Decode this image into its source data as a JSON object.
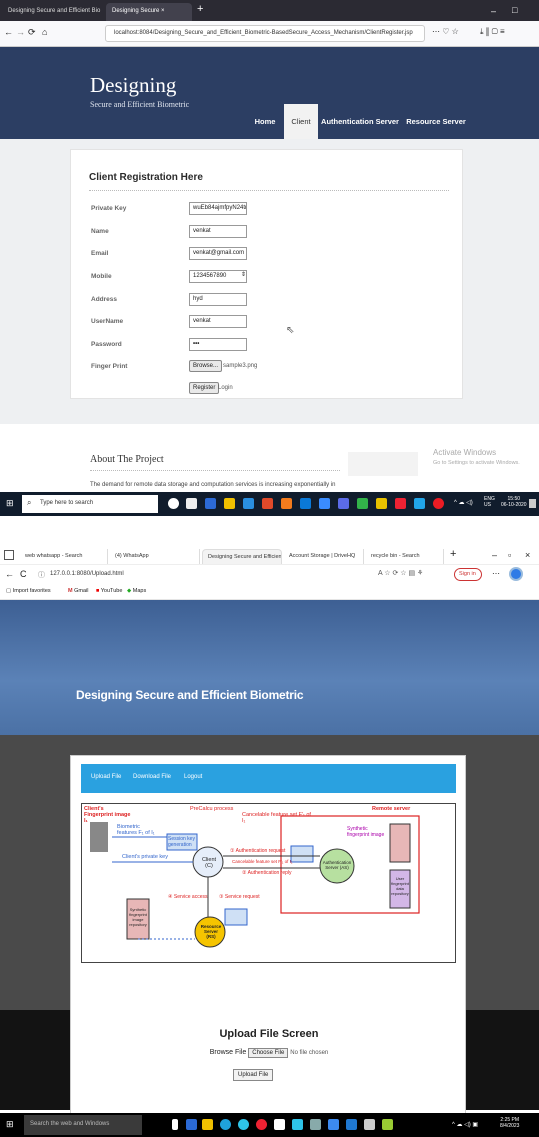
{
  "shot1": {
    "tabs": [
      {
        "label": "Designing Secure and Efficient Bio"
      },
      {
        "label": "Designing Secure"
      }
    ],
    "window_controls": {
      "minimize": "–",
      "close": "×"
    },
    "url": "localhost:8084/Designing_Secure_and_Efficient_Biometric-BasedSecure_Access_Mechanism/ClientRegister.jsp",
    "site_title": "Designing",
    "site_subtitle": "Secure and Efficient Biometric",
    "menu": [
      {
        "label": "Home"
      },
      {
        "label": "Client"
      },
      {
        "label": "Authentication Server"
      },
      {
        "label": "Resource Server"
      }
    ],
    "form_title": "Client Registration Here",
    "fields": [
      {
        "label": "Private Key",
        "value": "wuEb84ajmfpyN24truq"
      },
      {
        "label": "Name",
        "value": "venkat"
      },
      {
        "label": "Email",
        "value": "venkat@gmail.com"
      },
      {
        "label": "Mobile",
        "value": "1234567890"
      },
      {
        "label": "Address",
        "value": "hyd"
      },
      {
        "label": "UserName",
        "value": "venkat"
      },
      {
        "label": "Password",
        "value": "•••"
      }
    ],
    "finger_print_label": "Finger Print",
    "browse_label": "Browse...",
    "file_name": "sample3.png",
    "register_label": "Register",
    "login_label": "Login",
    "about_title": "About The Project",
    "about_text": "The demand for remote data storage and computation services is increasing exponentially in",
    "activate_title": "Activate Windows",
    "activate_sub": "Go to Settings to activate Windows.",
    "taskbar": {
      "search": "Type here to search",
      "lang": "ENG",
      "region": "US",
      "time": "15:50",
      "date": "06-10-2020"
    }
  },
  "shot2": {
    "tabs": [
      {
        "label": "web whatsapp - Search"
      },
      {
        "label": "(4) WhatsApp"
      },
      {
        "label": "Designing Secure and Efficien"
      },
      {
        "label": "Account Storage | DriveHQ"
      },
      {
        "label": "recycle bin - Search"
      }
    ],
    "url": "127.0.0.1:8080/Upload.html",
    "signin_label": "Sign in",
    "favorites": [
      {
        "label": "Import favorites"
      },
      {
        "label": "Gmail"
      },
      {
        "label": "YouTube"
      },
      {
        "label": "Maps"
      }
    ],
    "site_title": "Designing Secure and Efficient Biometric",
    "menu": [
      {
        "label": "Upload File"
      },
      {
        "label": "Download File"
      },
      {
        "label": "Logout"
      }
    ],
    "diagram": {
      "client_fp": "Client's Fingerprint image I₁",
      "biometric": "Biometric features F₁ of I₁",
      "precalcu": "PreCalcu process",
      "cancelable": "Cancelable feature set F'₁ of I₁",
      "remote": "Remote server",
      "session": "Session key generation",
      "private_key": "Client's private key",
      "client": "Client (C)",
      "auth_req": "① Authentication request",
      "cancel_set": "Cancelable feature set F'₁ of I₁",
      "auth_reply": "② Authentication reply",
      "auth_server": "Authentication Server (AS)",
      "synthetic": "Synthetic fingerprint image",
      "service_access": "④ Service access",
      "service_request": "③ Service request",
      "resource_server": "Resource Server (RS)",
      "synthetic_repo": "Synthetic fingerprint image repository",
      "user_repo": "User fingerprint data repository"
    },
    "upload_title": "Upload File Screen",
    "browse_label": "Browse File",
    "choose_label": "Choose File",
    "no_file": "No file chosen",
    "upload_button": "Upload File",
    "taskbar": {
      "search": "Search the web and Windows",
      "time": "2:25 PM",
      "date": "8/4/2023"
    }
  }
}
